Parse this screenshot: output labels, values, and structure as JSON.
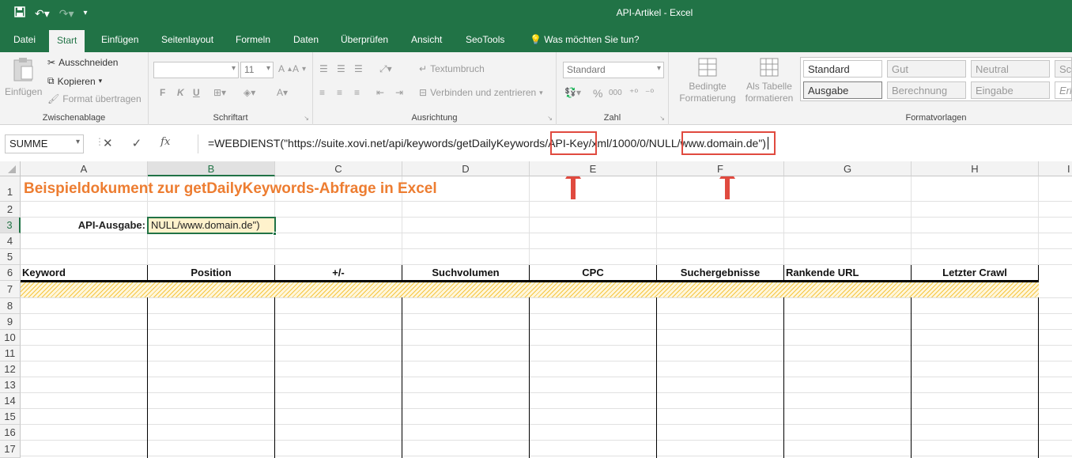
{
  "window": {
    "title": "API-Artikel - Excel"
  },
  "tabs": [
    "Datei",
    "Start",
    "Einfügen",
    "Seitenlayout",
    "Formeln",
    "Daten",
    "Überprüfen",
    "Ansicht",
    "SeoTools",
    "Was möchten Sie tun?"
  ],
  "active_tab": "Start",
  "ribbon": {
    "clipboard": {
      "paste": "Einfügen",
      "cut": "Ausschneiden",
      "copy": "Kopieren",
      "format_painter": "Format übertragen",
      "label": "Zwischenablage"
    },
    "font": {
      "font_size": "11",
      "bold": "F",
      "italic": "K",
      "underline": "U",
      "label": "Schriftart"
    },
    "alignment": {
      "wrap": "Textumbruch",
      "merge": "Verbinden und zentrieren",
      "label": "Ausrichtung"
    },
    "number": {
      "format": "Standard",
      "percent": "%",
      "thousands": "000",
      "label": "Zahl"
    },
    "styles": {
      "conditional": "Bedingte Formatierung",
      "as_table": "Als Tabelle formatieren",
      "cells": [
        "Standard",
        "Gut",
        "Neutral",
        "Sch",
        "Ausgabe",
        "Berechnung",
        "Eingabe",
        "Erk"
      ],
      "label": "Formatvorlagen"
    }
  },
  "formula_bar": {
    "name_box": "SUMME",
    "cancel": "✕",
    "enter": "✓",
    "fx": "fx",
    "formula_prefix": "=WEBDIENST(\"https://suite.xovi.net/api/keywords/getDailyKeywords/",
    "formula_api_key": "API-Key",
    "formula_mid": "/xml/1000/0/NULL/",
    "formula_domain": "www.domain.de\")"
  },
  "accent": "#217346",
  "highlight_color": "#e04a3f",
  "sheet": {
    "columns": [
      "A",
      "B",
      "C",
      "D",
      "E",
      "F",
      "G",
      "H",
      "I"
    ],
    "rows": [
      "1",
      "2",
      "3",
      "4",
      "5",
      "6",
      "7",
      "8",
      "9",
      "10",
      "11",
      "12",
      "13",
      "14",
      "15",
      "16",
      "17"
    ],
    "title": "Beispieldokument zur getDailyKeywords-Abfrage in Excel",
    "api_label": "API-Ausgabe:",
    "api_cell": "NULL/www.domain.de\")",
    "headers": [
      "Keyword",
      "Position",
      "+/-",
      "Suchvolumen",
      "CPC",
      "Suchergebnisse",
      "Rankende URL",
      "Letzter Crawl"
    ]
  }
}
